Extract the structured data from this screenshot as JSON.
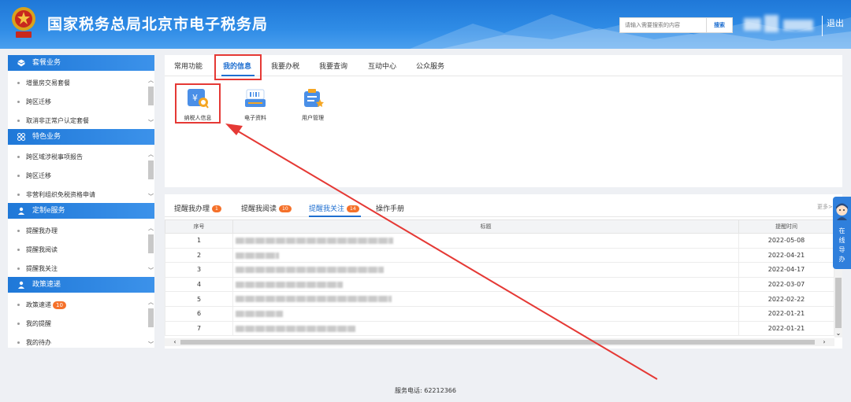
{
  "header": {
    "title": "国家税务总局北京市电子税务局",
    "search_placeholder": "请输入需要搜索的内容",
    "search_button": "搜索",
    "logout": "退出"
  },
  "sidebar": {
    "sections": [
      {
        "title": "套餐业务",
        "icon": "cube-icon",
        "items": [
          "增量房交易套餐",
          "跨区迁移",
          "取消非正常户认定套餐"
        ]
      },
      {
        "title": "特色业务",
        "icon": "grid-icon",
        "items": [
          "跨区域涉税事项报告",
          "跨区迁移",
          "非营利组织免税资格申请"
        ]
      },
      {
        "title": "定制e服务",
        "icon": "user-icon",
        "items": [
          "提醒我办理",
          "提醒我阅读",
          "提醒我关注"
        ]
      },
      {
        "title": "政策速递",
        "icon": "user-icon",
        "items": [
          "政策速递",
          "我的提醒",
          "我的待办"
        ],
        "badge": "10"
      }
    ]
  },
  "tabs": [
    "常用功能",
    "我的信息",
    "我要办税",
    "我要查询",
    "互动中心",
    "公众服务"
  ],
  "active_tab": "我的信息",
  "apps": [
    {
      "label": "纳税人信息",
      "icon": "taxpayer-info-icon"
    },
    {
      "label": "电子资料",
      "icon": "e-document-icon"
    },
    {
      "label": "用户管理",
      "icon": "user-management-icon"
    }
  ],
  "reminder_tabs": [
    {
      "label": "提醒我办理",
      "badge": "1"
    },
    {
      "label": "提醒我阅读",
      "badge": "10"
    },
    {
      "label": "提醒我关注",
      "badge": "14"
    },
    {
      "label": "操作手册",
      "badge": ""
    }
  ],
  "more": "更多>",
  "table": {
    "headers": [
      "序号",
      "标题",
      "提醒时间"
    ],
    "rows": [
      {
        "no": "1",
        "time": "2022-05-08"
      },
      {
        "no": "2",
        "time": "2022-04-21"
      },
      {
        "no": "3",
        "time": "2022-04-17"
      },
      {
        "no": "4",
        "time": "2022-03-07"
      },
      {
        "no": "5",
        "time": "2022-02-22"
      },
      {
        "no": "6",
        "time": "2022-01-21"
      },
      {
        "no": "7",
        "time": "2022-01-21"
      }
    ]
  },
  "guide_text": "在线导办",
  "footer": "服务电话: 62212366",
  "colors": {
    "primary": "#1f78d8",
    "highlight": "#e53935",
    "badge": "#f5712a"
  }
}
